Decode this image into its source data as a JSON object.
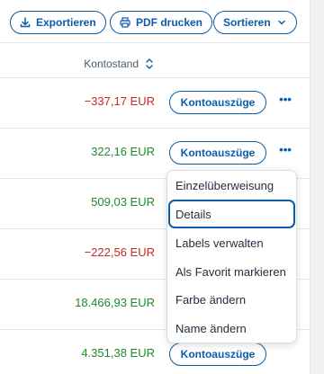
{
  "toolbar": {
    "export_label": "Exportieren",
    "pdf_label": "PDF drucken",
    "sort_label": "Sortieren"
  },
  "table": {
    "balance_header": "Kontostand",
    "rows": [
      {
        "amount": "−337,17 EUR",
        "sign": "negative",
        "button_label": "Kontoauszüge",
        "more": "•••"
      },
      {
        "amount": "322,16 EUR",
        "sign": "positive",
        "button_label": "Kontoauszüge",
        "more": "•••"
      },
      {
        "amount": "509,03 EUR",
        "sign": "positive"
      },
      {
        "amount": "−222,56 EUR",
        "sign": "negative"
      },
      {
        "amount": "18.466,93 EUR",
        "sign": "positive"
      },
      {
        "amount": "4.351,38 EUR",
        "sign": "positive",
        "button_label": "Kontoauszüge"
      }
    ]
  },
  "context_menu": {
    "items": [
      {
        "label": "Einzelüberweisung"
      },
      {
        "label": "Details",
        "focused": true
      },
      {
        "label": "Labels verwalten"
      },
      {
        "label": "Als Favorit markieren"
      },
      {
        "label": "Farbe ändern"
      },
      {
        "label": "Name ändern"
      }
    ]
  },
  "colors": {
    "accent": "#0b5cad",
    "negative": "#c62828",
    "positive": "#1f8a2e",
    "divider": "#e3e7ec"
  },
  "icons": {
    "export": "download-icon",
    "pdf": "printer-icon",
    "sort": "chevron-down-icon",
    "column_sort": "sort-updown-icon",
    "row_more": "more-horizontal-icon"
  }
}
